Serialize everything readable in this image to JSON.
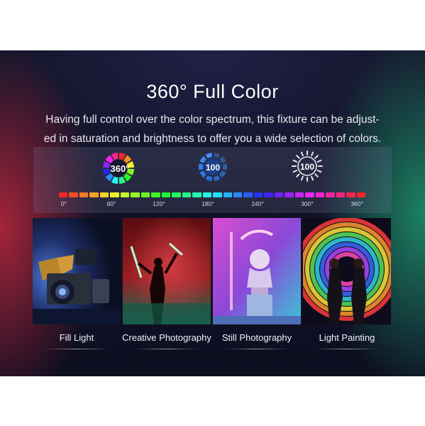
{
  "header": {
    "title": "360° Full Color",
    "description_line1": "Having full control over the color spectrum, this fixture can be adjust-",
    "description_line2": "ed in saturation and brightness to offer you a wide selection of colors."
  },
  "icons": {
    "hue": {
      "name": "hue-wheel-icon",
      "label": "360°"
    },
    "saturation": {
      "name": "saturation-dial-icon",
      "label": "100"
    },
    "brightness": {
      "name": "brightness-sun-icon",
      "label": "100"
    }
  },
  "spectrum": {
    "segments": 30,
    "ticks": [
      "0°",
      "60°",
      "120°",
      "180°",
      "240°",
      "300°",
      "360°"
    ]
  },
  "scenes": [
    {
      "label": "Fill Light"
    },
    {
      "label": "Creative Photography"
    },
    {
      "label": "Still Photography"
    },
    {
      "label": "Light Painting"
    }
  ],
  "colors": {
    "banner_bg": "#11122a",
    "text": "#ffffff",
    "saturation_icon": "#2f7be0",
    "brightness_icon": "#e8e8f0"
  }
}
